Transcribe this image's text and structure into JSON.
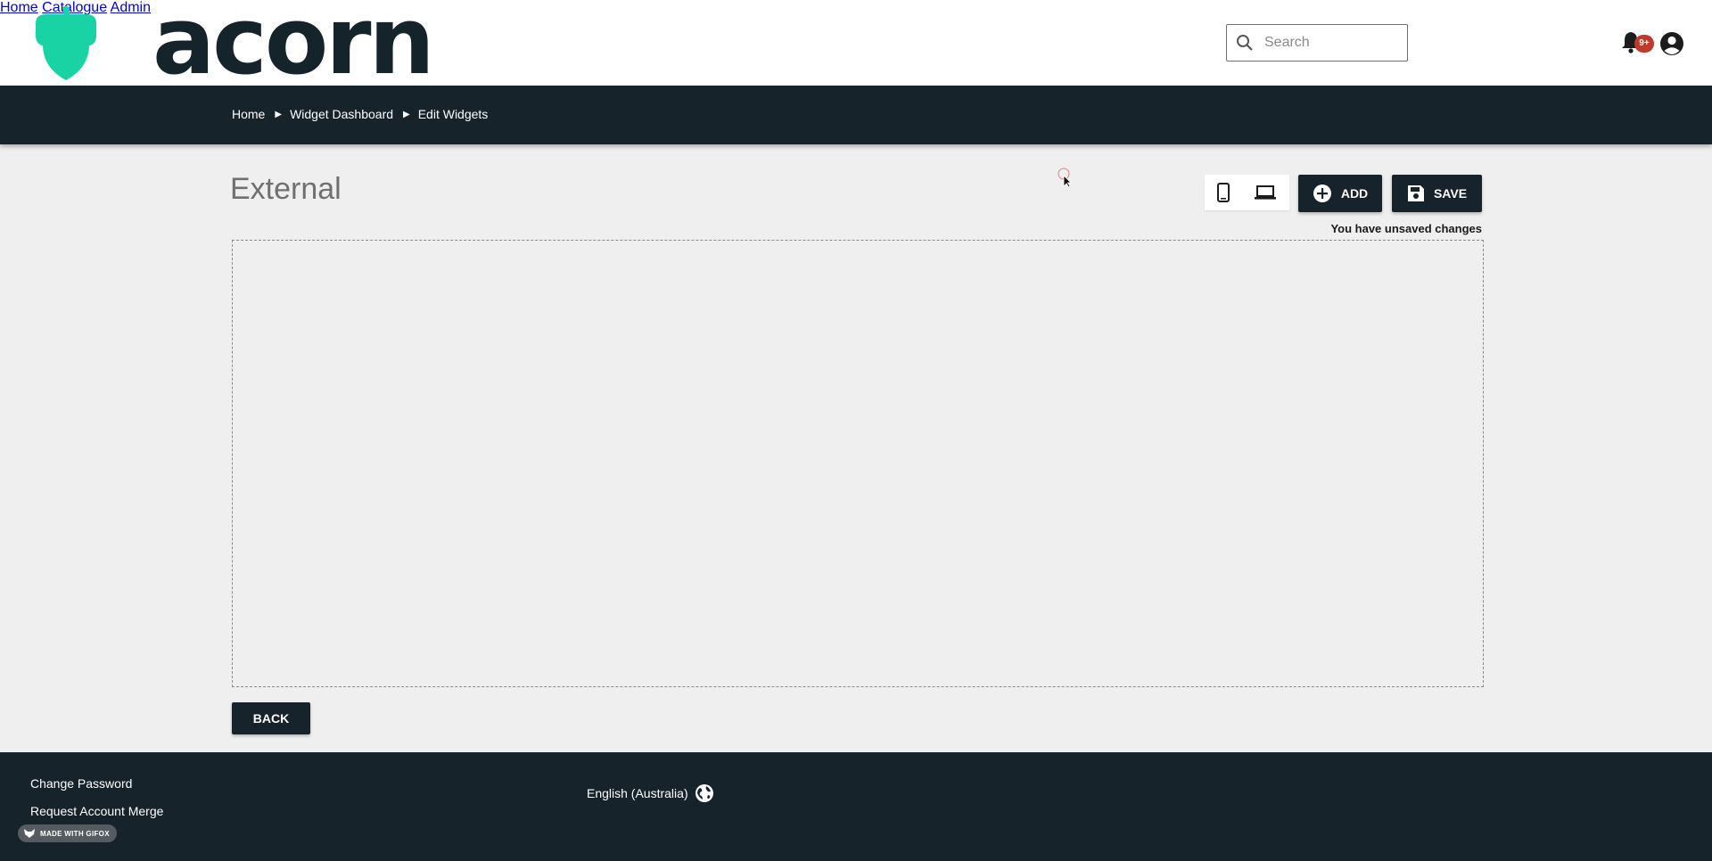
{
  "brand": {
    "name": "acorn",
    "color": "#19d3a4"
  },
  "header": {
    "search_placeholder": "Search",
    "nav": [
      "Home",
      "Catalogue",
      "Admin"
    ],
    "notification_badge": "9+"
  },
  "breadcrumb": [
    "Home",
    "Widget Dashboard",
    "Edit Widgets"
  ],
  "main": {
    "title": "External",
    "add_label": "ADD",
    "save_label": "SAVE",
    "unsaved_notice": "You have unsaved changes",
    "back_label": "BACK"
  },
  "footer": {
    "links": [
      "Change Password",
      "Request Account Merge"
    ],
    "language": "English (Australia)",
    "watermark": "MADE WITH GIFOX"
  },
  "colors": {
    "dark": "#17232a",
    "background": "#efefef",
    "badge": "#c0392b"
  },
  "icons": [
    "search-icon",
    "bell-icon",
    "account-circle-icon",
    "mobile-icon",
    "laptop-icon",
    "add-circle-icon",
    "save-icon",
    "globe-icon"
  ]
}
